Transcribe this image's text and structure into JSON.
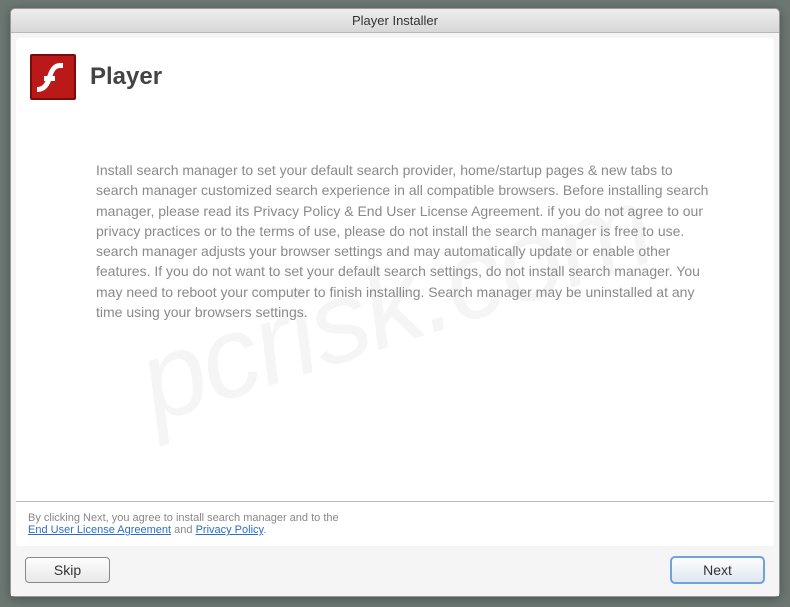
{
  "window": {
    "title": "Player Installer",
    "appTitle": "Player"
  },
  "body": {
    "text": "Install search manager to set your default search provider, home/startup pages & new tabs to search manager customized search experience in all compatible browsers. Before installing search manager, please read its Privacy Policy & End User License Agreement. if you do not agree to our privacy practices or to the terms of use, please do not install the search manager is free to use. search manager adjusts your browser settings and may automatically update or enable other features. If you do not want to set your default search settings, do not install search manager. You may need to reboot your computer to finish installing. Search manager may be uninstalled at any time using your browsers settings."
  },
  "footer": {
    "prefix": "By clicking Next, you agree to install search manager and to the ",
    "eula": "End User License Agreement",
    "and": " and ",
    "pp": "Privacy Policy",
    "suffix": "."
  },
  "buttons": {
    "skip": "Skip",
    "next": "Next"
  },
  "watermark": "pcrisk.com"
}
